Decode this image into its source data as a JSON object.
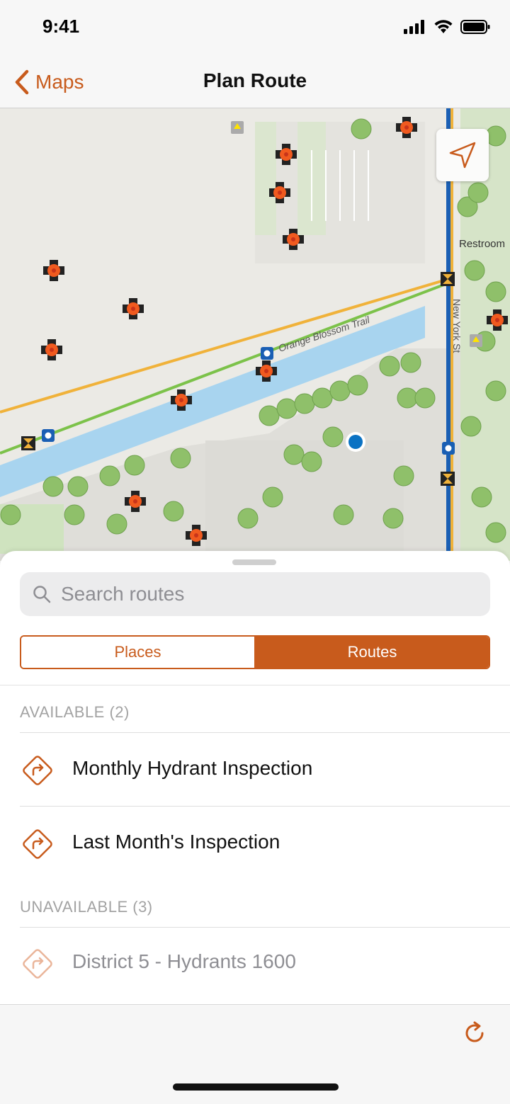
{
  "status_bar": {
    "time": "9:41"
  },
  "nav": {
    "back_label": "Maps",
    "title": "Plan Route"
  },
  "map": {
    "labels": {
      "trail": "Orange Blossom Trail",
      "street": "New York St",
      "poi": "Restroom"
    }
  },
  "search": {
    "placeholder": "Search routes",
    "value": ""
  },
  "segments": {
    "places": "Places",
    "routes": "Routes",
    "selected": "Routes"
  },
  "sections": {
    "available": {
      "header": "AVAILABLE (2)",
      "items": [
        {
          "label": "Monthly Hydrant Inspection",
          "icon": "route-icon"
        },
        {
          "label": "Last Month's Inspection",
          "icon": "route-icon"
        }
      ]
    },
    "unavailable": {
      "header": "UNAVAILABLE (3)",
      "items": [
        {
          "label": "District 5 - Hydrants 1600",
          "icon": "route-icon"
        }
      ]
    }
  },
  "colors": {
    "accent": "#c85b1c",
    "location": "#0a72c3",
    "water": "#a8d4ef"
  }
}
